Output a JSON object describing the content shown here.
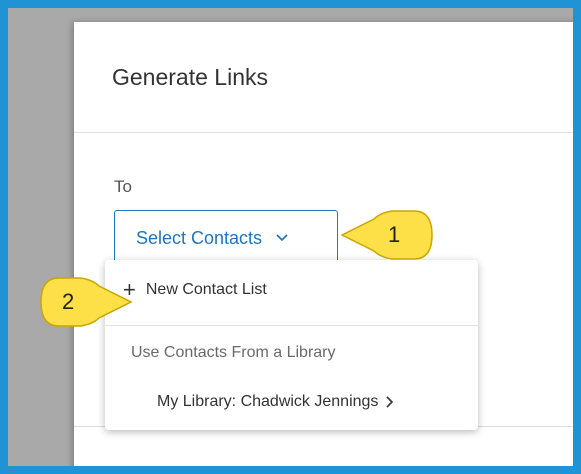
{
  "modal": {
    "title": "Generate Links",
    "to_label": "To",
    "select_button_label": "Select Contacts"
  },
  "dropdown": {
    "new_contact_list": "New Contact List",
    "group_label": "Use Contacts From a Library",
    "library_item": "My Library: Chadwick Jennings"
  },
  "callouts": {
    "step1": "1",
    "step2": "2",
    "color": "#fde047"
  },
  "icons": {
    "select_chevron": "chevron-down-icon",
    "new_list": "plus-icon",
    "library_chevron": "chevron-right-icon"
  }
}
